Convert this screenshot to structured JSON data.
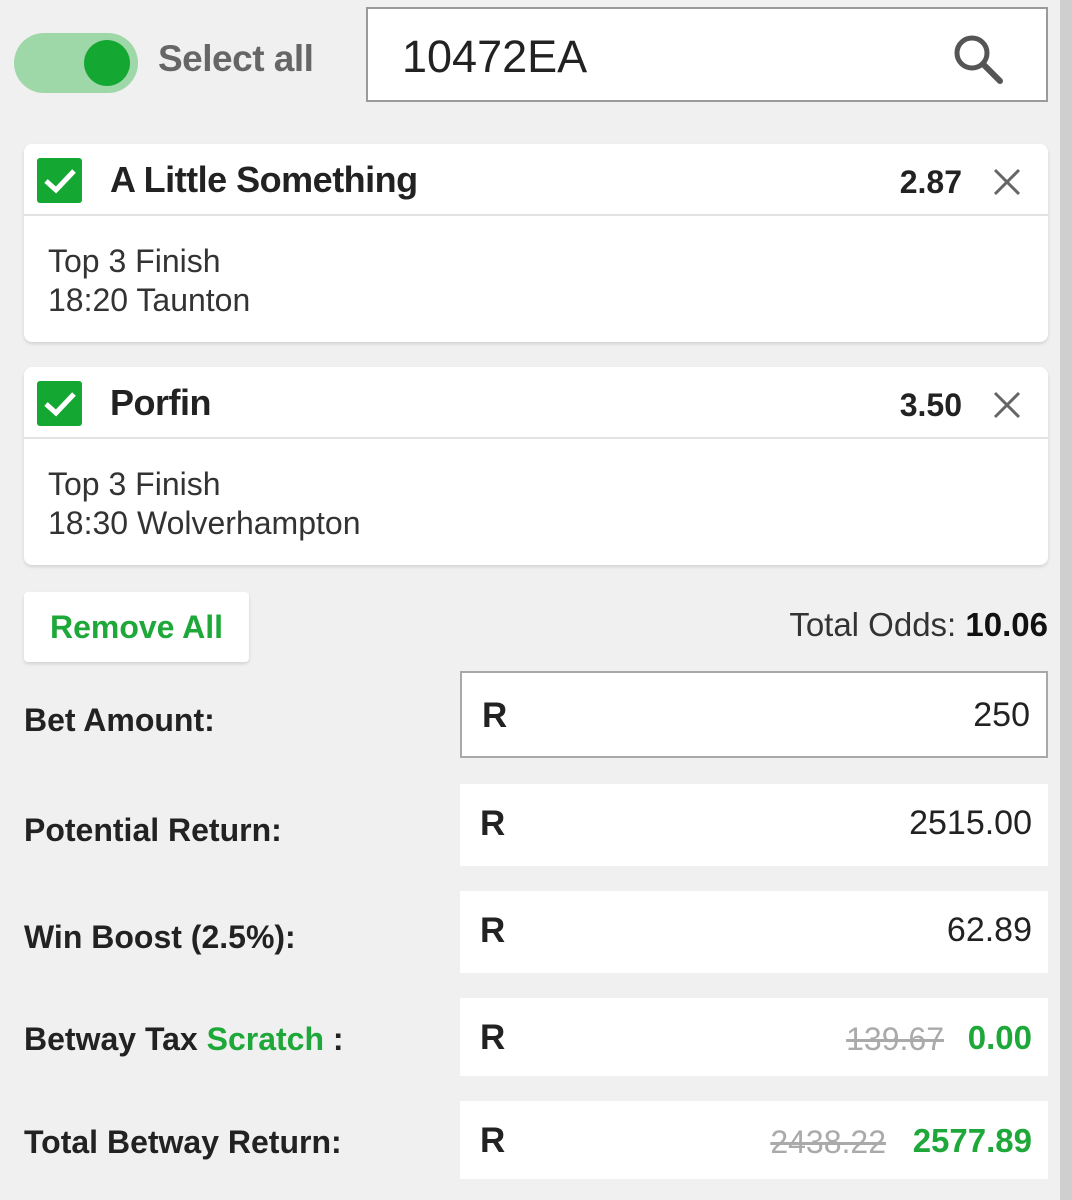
{
  "header": {
    "select_all_label": "Select all",
    "select_all_on": true,
    "search_value": "10472EA"
  },
  "selections": [
    {
      "name": "A Little Something",
      "odds": "2.87",
      "market": "Top 3 Finish",
      "event": "18:20 Taunton",
      "checked": true
    },
    {
      "name": "Porfin",
      "odds": "3.50",
      "market": "Top 3 Finish",
      "event": "18:30 Wolverhampton",
      "checked": true
    }
  ],
  "actions": {
    "remove_all_label": "Remove All"
  },
  "totals": {
    "total_odds_label": "Total Odds:",
    "total_odds_value": "10.06",
    "currency": "R",
    "bet_amount_label": "Bet Amount:",
    "bet_amount_value": "250",
    "potential_return_label": "Potential Return:",
    "potential_return_value": "2515.00",
    "win_boost_label": "Win Boost (2.5%):",
    "win_boost_value": "62.89",
    "tax_label_prefix": "Betway Tax",
    "tax_label_link": "Scratch",
    "tax_label_suffix": ":",
    "tax_old_value": "139.67",
    "tax_new_value": "0.00",
    "total_return_label": "Total Betway Return:",
    "total_return_old_value": "2438.22",
    "total_return_new_value": "2577.89"
  },
  "colors": {
    "brand_green": "#14a833",
    "toggle_track": "#9ed7a8"
  }
}
